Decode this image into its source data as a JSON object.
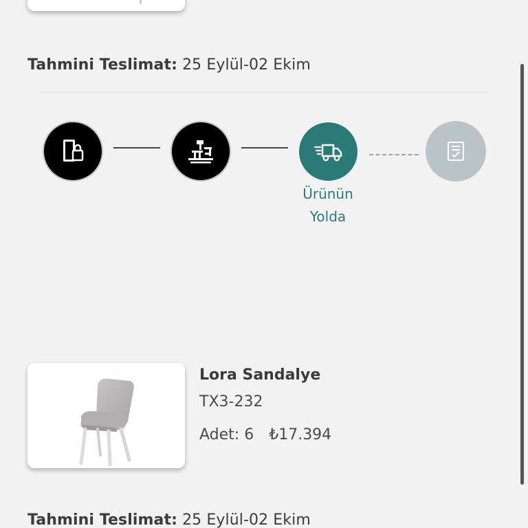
{
  "delivery": {
    "label": "Tahmini Teslimat:",
    "range": "25 Eylül-02 Ekim"
  },
  "tracker": {
    "steps": [
      {
        "icon": "order-door-icon",
        "state": "completed"
      },
      {
        "icon": "production-workshop-icon",
        "state": "completed"
      },
      {
        "icon": "delivery-truck-icon",
        "state": "active",
        "label_line1": "Ürünün",
        "label_line2": "Yolda"
      },
      {
        "icon": "delivered-receipt-icon",
        "state": "pending"
      }
    ]
  },
  "product": {
    "name": "Lora Sandalye",
    "code": "TX3-232",
    "quantity_label": "Adet: 6",
    "price": "₺17.394"
  },
  "colors": {
    "background": "#f2f2f2",
    "completed": "#000000",
    "active": "#2a7a78",
    "pending": "#b9c3c8"
  }
}
